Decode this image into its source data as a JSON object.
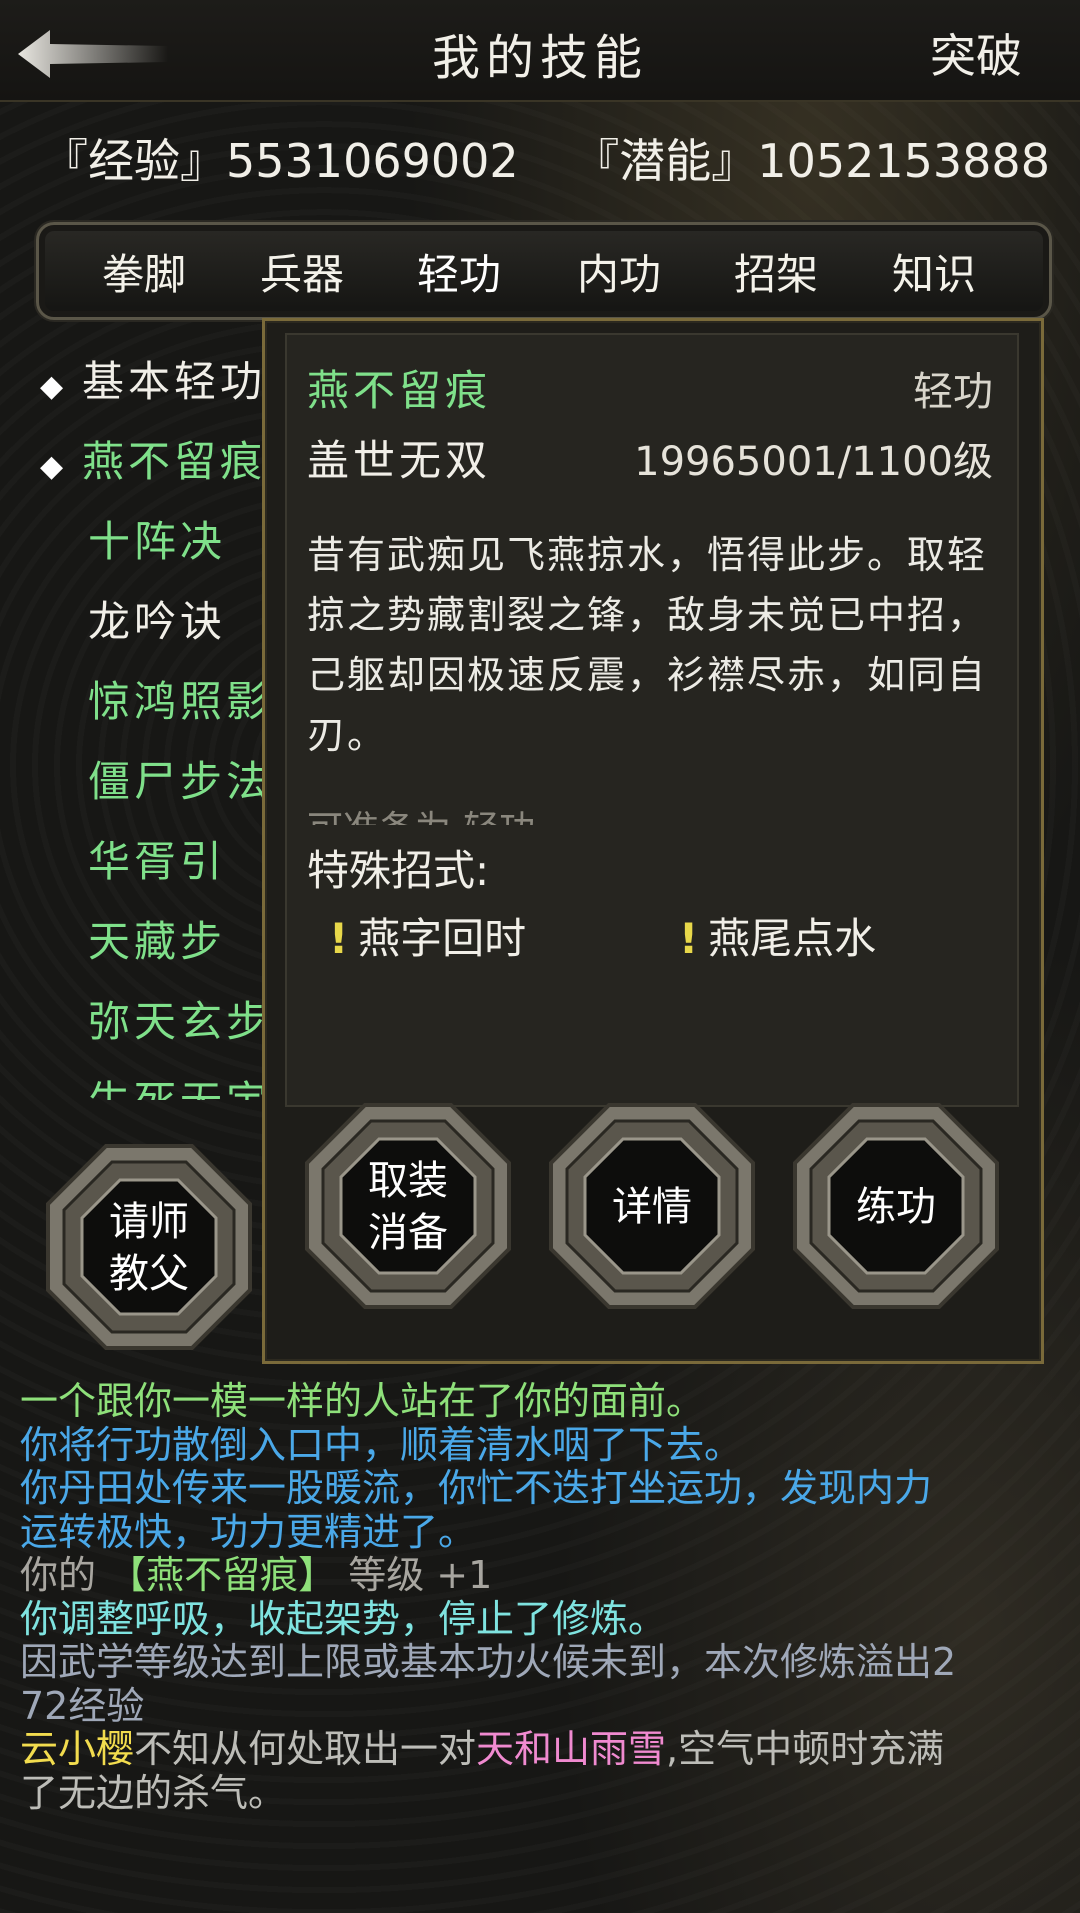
{
  "header": {
    "title": "我的技能",
    "breakthrough_label": "突破"
  },
  "stats": {
    "experience": "『经验』5531069002",
    "potential": "『潜能』1052153888"
  },
  "tabs": [
    {
      "label": "拳脚"
    },
    {
      "label": "兵器"
    },
    {
      "label": "轻功",
      "active": true
    },
    {
      "label": "内功"
    },
    {
      "label": "招架"
    },
    {
      "label": "知识"
    }
  ],
  "skills": [
    {
      "label": "基本轻功",
      "diamond": true,
      "color": "white"
    },
    {
      "label": "燕不留痕",
      "diamond": true,
      "color": "green"
    },
    {
      "label": "十阵决",
      "color": "green"
    },
    {
      "label": "龙吟诀",
      "color": "white"
    },
    {
      "label": "惊鸿照影",
      "color": "green"
    },
    {
      "label": "僵尸步法",
      "color": "green"
    },
    {
      "label": "华胥引",
      "color": "green"
    },
    {
      "label": "天藏步",
      "color": "green"
    },
    {
      "label": "弥天玄步",
      "color": "green"
    },
    {
      "label": "生死无定",
      "color": "green"
    }
  ],
  "detail": {
    "name": "燕不留痕",
    "type": "轻功",
    "rank": "盖世无双",
    "level": "19965001/1100级",
    "description": "昔有武痴见飞燕掠水，悟得此步。取轻掠之势藏割裂之锋，敌身未觉已中招，己躯却因极速反震，衫襟尽赤，如同自刃。",
    "equip_note": "可准备为:轻功",
    "special_label": "特殊招式:",
    "moves": [
      "燕字回时",
      "燕尾点水"
    ]
  },
  "buttons": {
    "teacher": [
      "请师",
      "教父"
    ],
    "unequip": [
      "取装",
      "消备"
    ],
    "details": "详情",
    "practice": "练功"
  },
  "log": [
    [
      {
        "t": "一个跟你一模一样的人站在了你的面前。",
        "c": "#8ee07a"
      }
    ],
    [
      {
        "t": "你将行功散倒入口中，顺着清水咽了下去。",
        "c": "#4aa8e8"
      }
    ],
    [
      {
        "t": "你丹田处传来一股暖流，你忙不迭打坐运功，发现内力",
        "c": "#4aa8e8"
      }
    ],
    [
      {
        "t": "运转极快，功力更精进了。",
        "c": "#4aa8e8"
      }
    ],
    [
      {
        "t": "你的 ",
        "c": "#a8a6a0"
      },
      {
        "t": "【燕不留痕】",
        "c": "#8ee07a"
      },
      {
        "t": " 等级 +1",
        "c": "#a8a6a0"
      }
    ],
    [
      {
        "t": "你调整呼吸，收起架势，停止了修炼。",
        "c": "#7fe3e0"
      }
    ],
    [
      {
        "t": "因武学等级达到上限或基本功火候未到，本次修炼溢出2",
        "c": "#9fa8b8"
      }
    ],
    [
      {
        "t": "72经验",
        "c": "#9fa8b8"
      }
    ],
    [
      {
        "t": "云小樱",
        "c": "#f2dc4e"
      },
      {
        "t": "不知从何处取出一对",
        "c": "#bdbdb8"
      },
      {
        "t": "天和山雨雪",
        "c": "#f08ad0"
      },
      {
        "t": ",空气中顿时充满",
        "c": "#bdbdb8"
      }
    ],
    [
      {
        "t": "了无边的杀气。",
        "c": "#bdbdb8"
      }
    ]
  ]
}
